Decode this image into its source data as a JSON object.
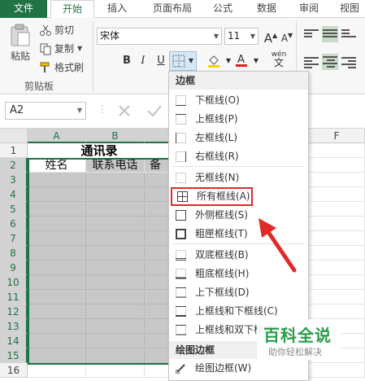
{
  "ribbon": {
    "tabs": [
      {
        "label": "文件"
      },
      {
        "label": "开始"
      },
      {
        "label": "插入"
      },
      {
        "label": "页面布局"
      },
      {
        "label": "公式"
      },
      {
        "label": "数据"
      },
      {
        "label": "审阅"
      },
      {
        "label": "视图"
      }
    ],
    "clipboard": {
      "paste": "粘贴",
      "cut": "剪切",
      "copy": "复制",
      "format_painter": "格式刷",
      "group_label": "剪贴板"
    },
    "font": {
      "name": "宋体",
      "size": "11",
      "bold": "B",
      "italic": "I",
      "underline": "U",
      "grow": "A",
      "shrink": "A",
      "phonetic": "wén"
    },
    "colors": {
      "accent": "#217346",
      "highlight": "#e02a2a",
      "fill": "#f5d300",
      "font_color": "#e02020"
    }
  },
  "formula_bar": {
    "name_box": "A2"
  },
  "sheet": {
    "columns": [
      "A",
      "B",
      "",
      "F"
    ],
    "rows": [
      "1",
      "2",
      "3",
      "4",
      "5",
      "6",
      "7",
      "8",
      "9",
      "10",
      "11",
      "12",
      "13",
      "14",
      "15",
      "16"
    ],
    "title": "通讯录",
    "headers": [
      "姓名",
      "联系电话",
      "备"
    ]
  },
  "border_menu": {
    "section1": "边框",
    "items": [
      "下框线(O)",
      "上框线(P)",
      "左框线(L)",
      "右框线(R)",
      "无框线(N)",
      "所有框线(A)",
      "外侧框线(S)",
      "粗匣框线(T)",
      "双底框线(B)",
      "粗底框线(H)",
      "上下框线(D)",
      "上框线和下框线(C)",
      "上框线和双下框线(U)"
    ],
    "section2": "绘图边框",
    "draw_item": "绘图边框(W)",
    "highlighted_index": 5
  },
  "watermark": {
    "title": "百科全说",
    "subtitle": "助你轻松解决"
  }
}
